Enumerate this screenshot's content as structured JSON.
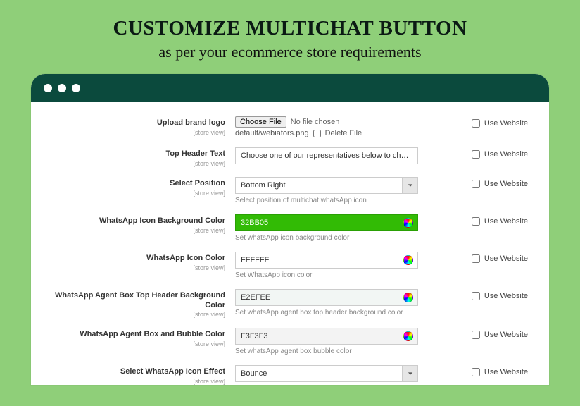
{
  "hero": {
    "title": "CUSTOMIZE MULTICHAT BUTTON",
    "subtitle": "as per your ecommerce store requirements"
  },
  "scope_label": "[store view]",
  "use_website_label": "Use Website",
  "rows": {
    "upload_logo": {
      "label": "Upload brand logo",
      "choose_btn": "Choose File",
      "no_file": "No file chosen",
      "current_file": "default/webiators.png",
      "delete_label": "Delete File"
    },
    "top_header_text": {
      "label": "Top Header Text",
      "value": "Choose one of our representatives below to chat on WhatsApp"
    },
    "select_position": {
      "label": "Select Position",
      "value": "Bottom Right",
      "helper": "Select position of multichat whatsApp icon"
    },
    "icon_bg": {
      "label": "WhatsApp Icon Background Color",
      "value": "32BB05",
      "helper": "Set whatsApp icon background color"
    },
    "icon_color": {
      "label": "WhatsApp Icon Color",
      "value": "FFFFFF",
      "helper": "Set WhatsApp icon color"
    },
    "agent_box_header_bg": {
      "label": "WhatsApp Agent Box Top Header Background Color",
      "value": "E2EFEE",
      "helper": "Set whatsApp agent box top header background color"
    },
    "agent_box_bubble": {
      "label": "WhatsApp Agent Box and Bubble Color",
      "value": "F3F3F3",
      "helper": "Set whatsApp agent box bubble color"
    },
    "icon_effect": {
      "label": "Select WhatsApp Icon Effect",
      "value": "Bounce"
    }
  }
}
